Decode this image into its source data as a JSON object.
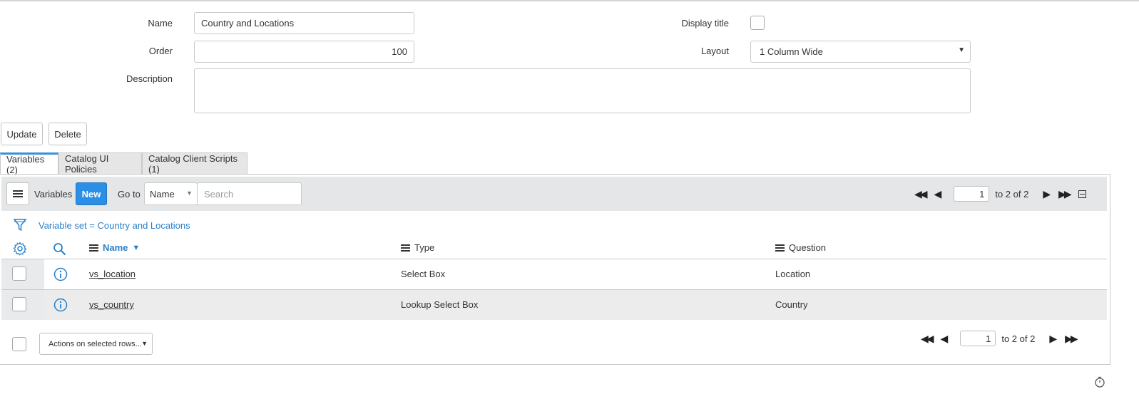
{
  "form": {
    "name_label": "Name",
    "name_value": "Country and Locations",
    "order_label": "Order",
    "order_value": "100",
    "description_label": "Description",
    "description_value": "",
    "display_title_label": "Display title",
    "display_title_checked": false,
    "layout_label": "Layout",
    "layout_value": "1 Column Wide"
  },
  "buttons": {
    "update": "Update",
    "delete": "Delete"
  },
  "tabs": [
    {
      "label": "Variables (2)",
      "active": true
    },
    {
      "label": "Catalog UI Policies",
      "active": false
    },
    {
      "label": "Catalog Client Scripts (1)",
      "active": false
    }
  ],
  "list": {
    "title": "Variables",
    "new_label": "New",
    "goto_label": "Go to",
    "goto_field": "Name",
    "search_placeholder": "Search",
    "page_value": "1",
    "page_range": "to 2 of 2",
    "filter_text": "Variable set = Country and Locations",
    "columns": [
      {
        "label": "Name",
        "sorted": "desc"
      },
      {
        "label": "Type"
      },
      {
        "label": "Question"
      }
    ],
    "rows": [
      {
        "name": "vs_location",
        "type": "Select Box",
        "question": "Location"
      },
      {
        "name": "vs_country",
        "type": "Lookup Select Box",
        "question": "Country"
      }
    ],
    "actions_label": "Actions on selected rows...",
    "footer_page_value": "1",
    "footer_page_range": "to 2 of 2"
  },
  "colors": {
    "accent": "#2c8fe6",
    "link": "#2a7fc8",
    "toolbar_bg": "#e4e6e8"
  }
}
